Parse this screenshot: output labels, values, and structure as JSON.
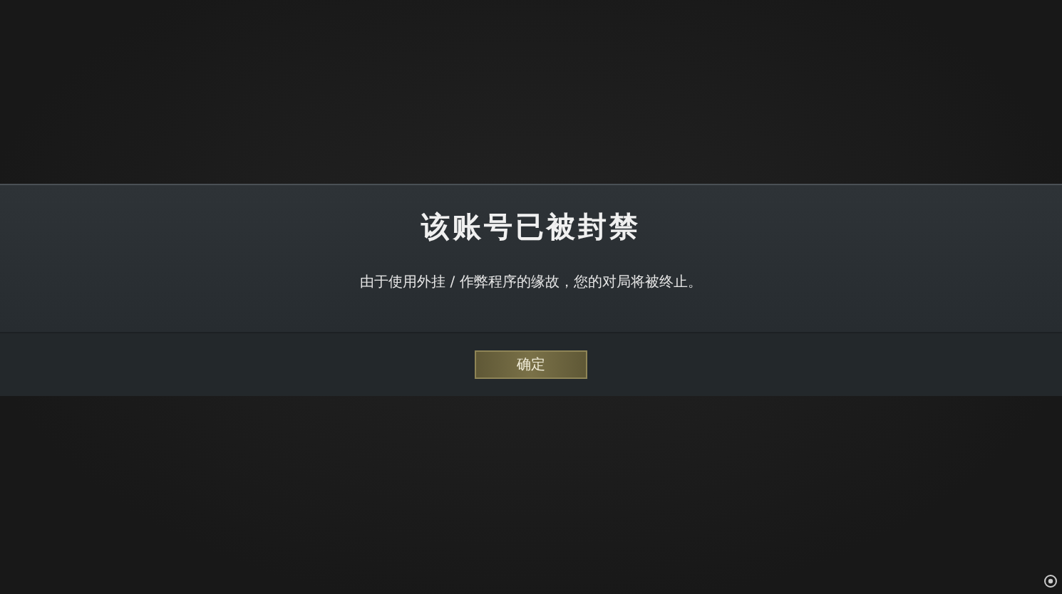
{
  "dialog": {
    "title": "该账号已被封禁",
    "message": "由于使用外挂 / 作弊程序的缘故，您的对局将被终止。",
    "buttons": [
      "确定"
    ]
  }
}
